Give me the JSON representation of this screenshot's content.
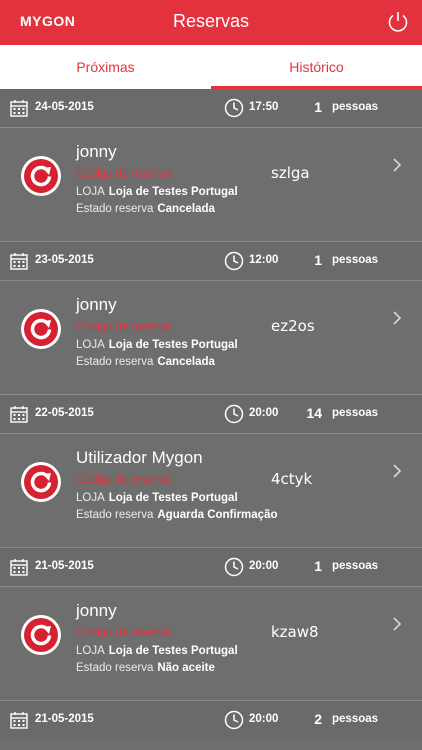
{
  "header": {
    "logo": "MYGON",
    "title": "Reservas"
  },
  "tabs": {
    "upcoming": "Próximas",
    "history": "Histórico"
  },
  "labels": {
    "people": "pessoas",
    "code": "Código de reserva:",
    "store": "LOJA",
    "status": "Estado reserva"
  },
  "reservations": [
    {
      "date": "24-05-2015",
      "time": "17:50",
      "people": "1",
      "user": "jonny",
      "code": "szlga",
      "store": "Loja de Testes Portugal",
      "status": "Cancelada"
    },
    {
      "date": "23-05-2015",
      "time": "12:00",
      "people": "1",
      "user": "jonny",
      "code": "ez2os",
      "store": "Loja de Testes Portugal",
      "status": "Cancelada"
    },
    {
      "date": "22-05-2015",
      "time": "20:00",
      "people": "14",
      "user": "Utilizador Mygon",
      "code": "4ctyk",
      "store": "Loja de Testes Portugal",
      "status": "Aguarda Confirmação"
    },
    {
      "date": "21-05-2015",
      "time": "20:00",
      "people": "1",
      "user": "jonny",
      "code": "kzaw8",
      "store": "Loja de Testes Portugal",
      "status": "Não aceite"
    },
    {
      "date": "21-05-2015",
      "time": "20:00",
      "people": "2"
    }
  ],
  "colors": {
    "brand": "#e3323e",
    "background": "#6e6e6e"
  },
  "icons": {
    "power": "power-icon",
    "calendar": "calendar-icon",
    "clock": "clock-icon",
    "chevron": "chevron-right-icon",
    "store_logo": "store-logo-icon"
  }
}
